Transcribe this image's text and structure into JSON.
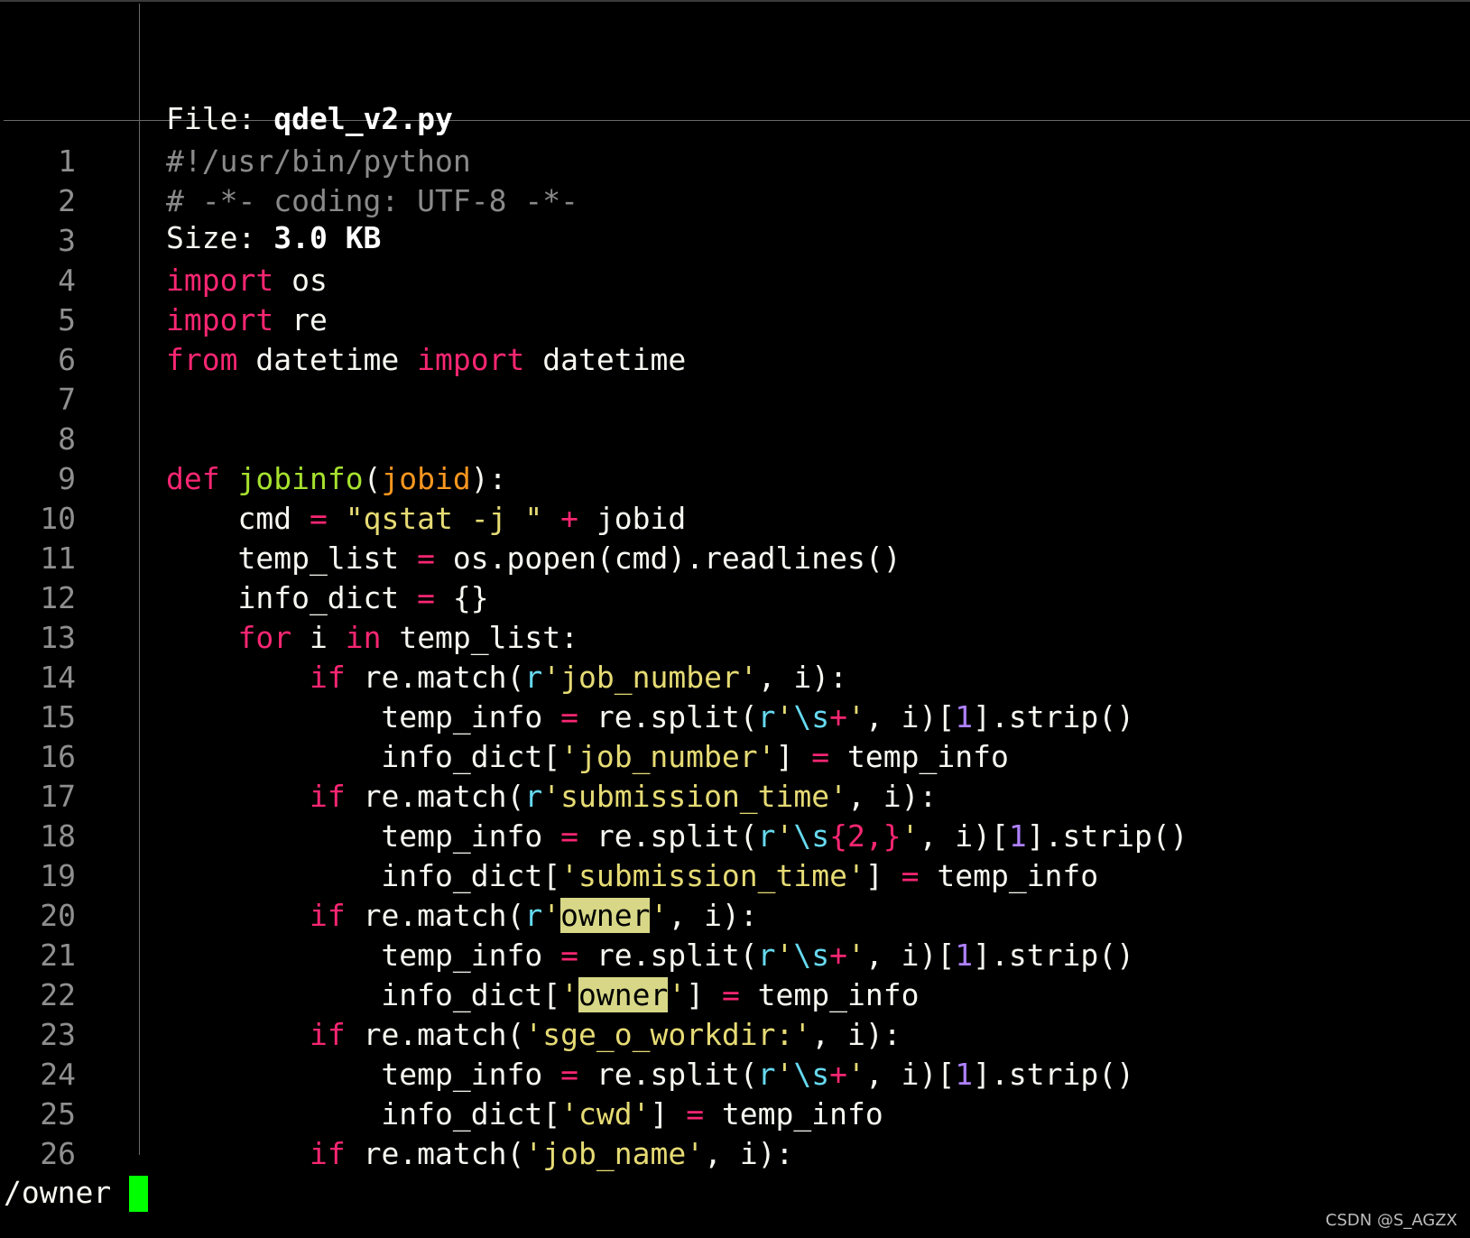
{
  "header": {
    "file_label": "File: ",
    "file_name": "qdel_v2.py",
    "size_label": "Size: ",
    "size_value": "3.0 KB"
  },
  "lines": [
    {
      "n": "1",
      "tokens": [
        {
          "t": "#!/usr/bin/python",
          "c": "cm"
        }
      ]
    },
    {
      "n": "2",
      "tokens": [
        {
          "t": "# -*- coding: UTF-8 -*-",
          "c": "cm"
        }
      ]
    },
    {
      "n": "3",
      "tokens": []
    },
    {
      "n": "4",
      "tokens": [
        {
          "t": "import",
          "c": "kw"
        },
        {
          "t": " os",
          "c": ""
        }
      ]
    },
    {
      "n": "5",
      "tokens": [
        {
          "t": "import",
          "c": "kw"
        },
        {
          "t": " re",
          "c": ""
        }
      ]
    },
    {
      "n": "6",
      "tokens": [
        {
          "t": "from",
          "c": "kw"
        },
        {
          "t": " datetime ",
          "c": ""
        },
        {
          "t": "import",
          "c": "kw"
        },
        {
          "t": " datetime",
          "c": ""
        }
      ]
    },
    {
      "n": "7",
      "tokens": []
    },
    {
      "n": "8",
      "tokens": []
    },
    {
      "n": "9",
      "tokens": [
        {
          "t": "def",
          "c": "kw"
        },
        {
          "t": " ",
          "c": ""
        },
        {
          "t": "jobinfo",
          "c": "fn"
        },
        {
          "t": "(",
          "c": ""
        },
        {
          "t": "jobid",
          "c": "ar"
        },
        {
          "t": "):",
          "c": ""
        }
      ]
    },
    {
      "n": "10",
      "tokens": [
        {
          "t": "    cmd ",
          "c": ""
        },
        {
          "t": "=",
          "c": "kw"
        },
        {
          "t": " ",
          "c": ""
        },
        {
          "t": "\"qstat -j \"",
          "c": "st"
        },
        {
          "t": " ",
          "c": ""
        },
        {
          "t": "+",
          "c": "kw"
        },
        {
          "t": " jobid",
          "c": ""
        }
      ]
    },
    {
      "n": "11",
      "tokens": [
        {
          "t": "    temp_list ",
          "c": ""
        },
        {
          "t": "=",
          "c": "kw"
        },
        {
          "t": " os.popen(cmd).readlines()",
          "c": ""
        }
      ]
    },
    {
      "n": "12",
      "tokens": [
        {
          "t": "    info_dict ",
          "c": ""
        },
        {
          "t": "=",
          "c": "kw"
        },
        {
          "t": " {}",
          "c": ""
        }
      ]
    },
    {
      "n": "13",
      "tokens": [
        {
          "t": "    ",
          "c": ""
        },
        {
          "t": "for",
          "c": "kw"
        },
        {
          "t": " i ",
          "c": ""
        },
        {
          "t": "in",
          "c": "kw"
        },
        {
          "t": " temp_list:",
          "c": ""
        }
      ]
    },
    {
      "n": "14",
      "tokens": [
        {
          "t": "        ",
          "c": ""
        },
        {
          "t": "if",
          "c": "kw"
        },
        {
          "t": " re.match(",
          "c": ""
        },
        {
          "t": "r",
          "c": "sp"
        },
        {
          "t": "'job_number'",
          "c": "st"
        },
        {
          "t": ", i):",
          "c": ""
        }
      ]
    },
    {
      "n": "15",
      "tokens": [
        {
          "t": "            temp_info ",
          "c": ""
        },
        {
          "t": "=",
          "c": "kw"
        },
        {
          "t": " re.split(",
          "c": ""
        },
        {
          "t": "r",
          "c": "sp"
        },
        {
          "t": "'",
          "c": "st"
        },
        {
          "t": "\\s",
          "c": "sp"
        },
        {
          "t": "+",
          "c": "kw"
        },
        {
          "t": "'",
          "c": "st"
        },
        {
          "t": ", i)[",
          "c": ""
        },
        {
          "t": "1",
          "c": "nm"
        },
        {
          "t": "].strip()",
          "c": ""
        }
      ]
    },
    {
      "n": "16",
      "tokens": [
        {
          "t": "            info_dict[",
          "c": ""
        },
        {
          "t": "'job_number'",
          "c": "st"
        },
        {
          "t": "] ",
          "c": ""
        },
        {
          "t": "=",
          "c": "kw"
        },
        {
          "t": " temp_info",
          "c": ""
        }
      ]
    },
    {
      "n": "17",
      "tokens": [
        {
          "t": "        ",
          "c": ""
        },
        {
          "t": "if",
          "c": "kw"
        },
        {
          "t": " re.match(",
          "c": ""
        },
        {
          "t": "r",
          "c": "sp"
        },
        {
          "t": "'submission_time'",
          "c": "st"
        },
        {
          "t": ", i):",
          "c": ""
        }
      ]
    },
    {
      "n": "18",
      "tokens": [
        {
          "t": "            temp_info ",
          "c": ""
        },
        {
          "t": "=",
          "c": "kw"
        },
        {
          "t": " re.split(",
          "c": ""
        },
        {
          "t": "r",
          "c": "sp"
        },
        {
          "t": "'",
          "c": "st"
        },
        {
          "t": "\\s",
          "c": "sp"
        },
        {
          "t": "{2,}",
          "c": "kw"
        },
        {
          "t": "'",
          "c": "st"
        },
        {
          "t": ", i)[",
          "c": ""
        },
        {
          "t": "1",
          "c": "nm"
        },
        {
          "t": "].strip()",
          "c": ""
        }
      ]
    },
    {
      "n": "19",
      "tokens": [
        {
          "t": "            info_dict[",
          "c": ""
        },
        {
          "t": "'submission_time'",
          "c": "st"
        },
        {
          "t": "] ",
          "c": ""
        },
        {
          "t": "=",
          "c": "kw"
        },
        {
          "t": " temp_info",
          "c": ""
        }
      ]
    },
    {
      "n": "20",
      "tokens": [
        {
          "t": "        ",
          "c": ""
        },
        {
          "t": "if",
          "c": "kw"
        },
        {
          "t": " re.match(",
          "c": ""
        },
        {
          "t": "r",
          "c": "sp"
        },
        {
          "t": "'",
          "c": "st"
        },
        {
          "t": "owner",
          "c": "hl"
        },
        {
          "t": "'",
          "c": "st"
        },
        {
          "t": ", i):",
          "c": ""
        }
      ]
    },
    {
      "n": "21",
      "tokens": [
        {
          "t": "            temp_info ",
          "c": ""
        },
        {
          "t": "=",
          "c": "kw"
        },
        {
          "t": " re.split(",
          "c": ""
        },
        {
          "t": "r",
          "c": "sp"
        },
        {
          "t": "'",
          "c": "st"
        },
        {
          "t": "\\s",
          "c": "sp"
        },
        {
          "t": "+",
          "c": "kw"
        },
        {
          "t": "'",
          "c": "st"
        },
        {
          "t": ", i)[",
          "c": ""
        },
        {
          "t": "1",
          "c": "nm"
        },
        {
          "t": "].strip()",
          "c": ""
        }
      ]
    },
    {
      "n": "22",
      "tokens": [
        {
          "t": "            info_dict[",
          "c": ""
        },
        {
          "t": "'",
          "c": "st"
        },
        {
          "t": "owner",
          "c": "hl"
        },
        {
          "t": "'",
          "c": "st"
        },
        {
          "t": "] ",
          "c": ""
        },
        {
          "t": "=",
          "c": "kw"
        },
        {
          "t": " temp_info",
          "c": ""
        }
      ]
    },
    {
      "n": "23",
      "tokens": [
        {
          "t": "        ",
          "c": ""
        },
        {
          "t": "if",
          "c": "kw"
        },
        {
          "t": " re.match(",
          "c": ""
        },
        {
          "t": "'sge_o_workdir:'",
          "c": "st"
        },
        {
          "t": ", i):",
          "c": ""
        }
      ]
    },
    {
      "n": "24",
      "tokens": [
        {
          "t": "            temp_info ",
          "c": ""
        },
        {
          "t": "=",
          "c": "kw"
        },
        {
          "t": " re.split(",
          "c": ""
        },
        {
          "t": "r",
          "c": "sp"
        },
        {
          "t": "'",
          "c": "st"
        },
        {
          "t": "\\s",
          "c": "sp"
        },
        {
          "t": "+",
          "c": "kw"
        },
        {
          "t": "'",
          "c": "st"
        },
        {
          "t": ", i)[",
          "c": ""
        },
        {
          "t": "1",
          "c": "nm"
        },
        {
          "t": "].strip()",
          "c": ""
        }
      ]
    },
    {
      "n": "25",
      "tokens": [
        {
          "t": "            info_dict[",
          "c": ""
        },
        {
          "t": "'cwd'",
          "c": "st"
        },
        {
          "t": "] ",
          "c": ""
        },
        {
          "t": "=",
          "c": "kw"
        },
        {
          "t": " temp_info",
          "c": ""
        }
      ]
    },
    {
      "n": "26",
      "tokens": [
        {
          "t": "        ",
          "c": ""
        },
        {
          "t": "if",
          "c": "kw"
        },
        {
          "t": " re.match(",
          "c": ""
        },
        {
          "t": "'job_name'",
          "c": "st"
        },
        {
          "t": ", i):",
          "c": ""
        }
      ]
    }
  ],
  "command_line": {
    "text": "/owner"
  },
  "watermark": "CSDN @S_AGZX",
  "colors": {
    "background": "#000000",
    "keyword": "#f92672",
    "comment": "#8a8a8a",
    "string": "#e6db74",
    "function": "#a6e22e",
    "argument": "#fd971f",
    "special": "#66d9ef",
    "number": "#ae81ff",
    "search_highlight": "#d7d787",
    "cursor": "#00ff00"
  }
}
